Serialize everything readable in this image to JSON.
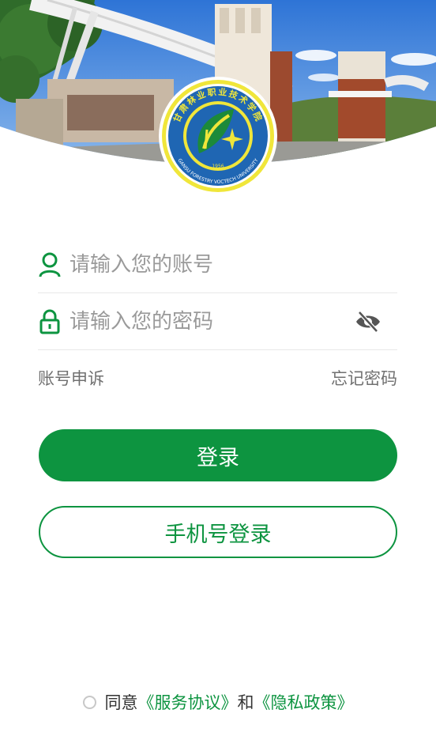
{
  "logo": {
    "top_text": "甘肃林业职业技术学院",
    "bottom_text": "GANSU FORESTRY VOCTECH UNIVERSITY",
    "year": "1956"
  },
  "form": {
    "account_placeholder": "请输入您的账号",
    "password_placeholder": "请输入您的密码"
  },
  "links": {
    "appeal": "账号申诉",
    "forgot": "忘记密码"
  },
  "buttons": {
    "login": "登录",
    "phone_login": "手机号登录"
  },
  "agreement": {
    "agree": "同意",
    "service": "《服务协议》",
    "and": "和",
    "privacy": "《隐私政策》"
  },
  "colors": {
    "primary": "#0d9440",
    "logo_blue": "#1f66b3",
    "logo_yellow": "#f0e63a"
  },
  "icons": {
    "account": "user-icon",
    "password": "lock-icon",
    "visibility": "eye-off-icon",
    "agree": "radio-unchecked-icon"
  }
}
